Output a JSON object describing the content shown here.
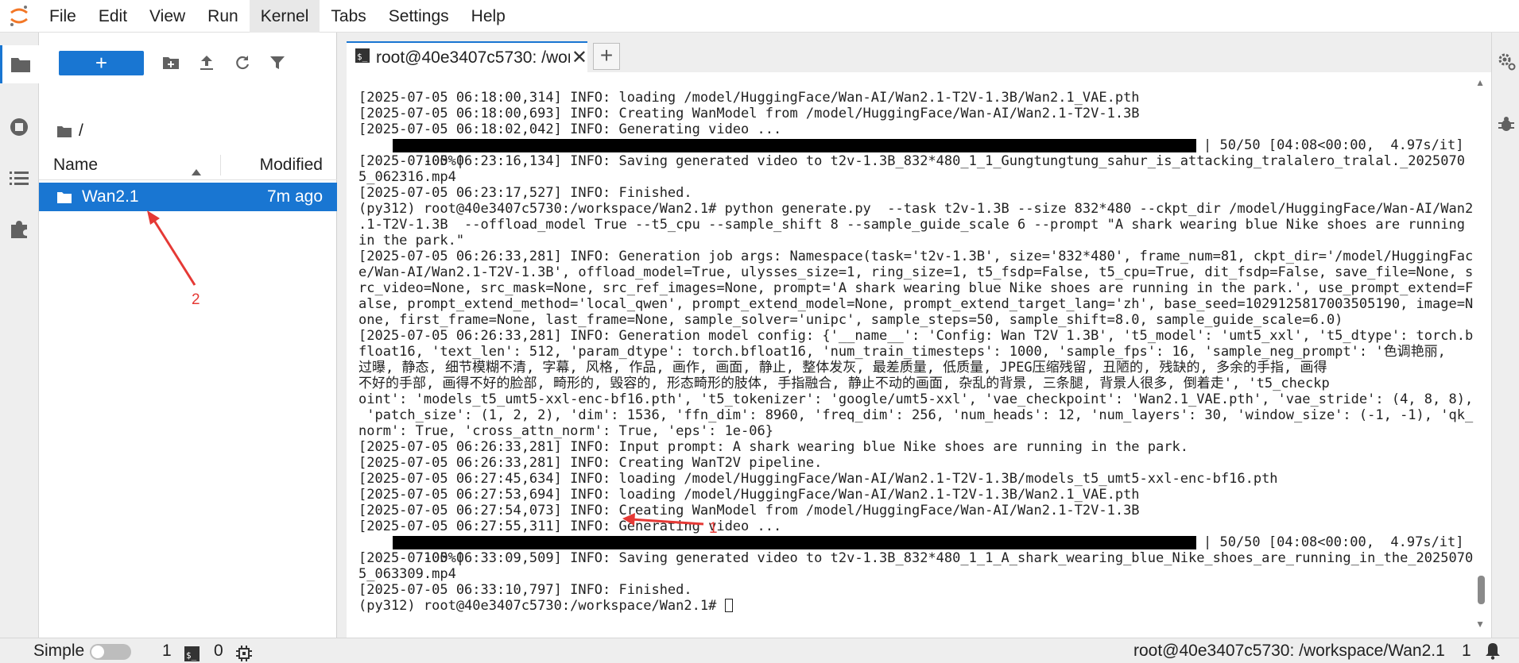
{
  "menu": [
    "File",
    "Edit",
    "View",
    "Run",
    "Kernel",
    "Tabs",
    "Settings",
    "Help"
  ],
  "filebrowser": {
    "new_label": "+",
    "breadcrumb": "/",
    "col_name": "Name",
    "col_modified": "Modified",
    "files": [
      {
        "name": "Wan2.1",
        "modified": "7m ago"
      }
    ]
  },
  "tab": {
    "label": "root@40e3407c5730: /wor",
    "close": "✕",
    "add": "+"
  },
  "terminal": {
    "lines_a": [
      "[2025-07-05 06:18:00,314] INFO: loading /model/HuggingFace/Wan-AI/Wan2.1-T2V-1.3B/Wan2.1_VAE.pth",
      "[2025-07-05 06:18:00,693] INFO: Creating WanModel from /model/HuggingFace/Wan-AI/Wan2.1-T2V-1.3B",
      "[2025-07-05 06:18:02,042] INFO: Generating video ..."
    ],
    "progress1_start": "100%|",
    "progress1_end": "| 50/50 [04:08<00:00,  4.97s/it]",
    "lines_b": [
      "[2025-07-05 06:23:16,134] INFO: Saving generated video to t2v-1.3B_832*480_1_1_Gungtungtung_sahur_is_attacking_tralalero_tralal._2025070",
      "5_062316.mp4",
      "[2025-07-05 06:23:17,527] INFO: Finished.",
      "(py312) root@40e3407c5730:/workspace/Wan2.1# python generate.py  --task t2v-1.3B --size 832*480 --ckpt_dir /model/HuggingFace/Wan-AI/Wan2",
      ".1-T2V-1.3B  --offload_model True --t5_cpu --sample_shift 8 --sample_guide_scale 6 --prompt \"A shark wearing blue Nike shoes are running",
      "in the park.\"",
      "[2025-07-05 06:26:33,281] INFO: Generation job args: Namespace(task='t2v-1.3B', size='832*480', frame_num=81, ckpt_dir='/model/HuggingFac",
      "e/Wan-AI/Wan2.1-T2V-1.3B', offload_model=True, ulysses_size=1, ring_size=1, t5_fsdp=False, t5_cpu=True, dit_fsdp=False, save_file=None, s",
      "rc_video=None, src_mask=None, src_ref_images=None, prompt='A shark wearing blue Nike shoes are running in the park.', use_prompt_extend=F",
      "alse, prompt_extend_method='local_qwen', prompt_extend_model=None, prompt_extend_target_lang='zh', base_seed=1029125817003505190, image=N",
      "one, first_frame=None, last_frame=None, sample_solver='unipc', sample_steps=50, sample_shift=8.0, sample_guide_scale=6.0)",
      "[2025-07-05 06:26:33,281] INFO: Generation model config: {'__name__': 'Config: Wan T2V 1.3B', 't5_model': 'umt5_xxl', 't5_dtype': torch.b",
      "float16, 'text_len': 512, 'param_dtype': torch.bfloat16, 'num_train_timesteps': 1000, 'sample_fps': 16, 'sample_neg_prompt': '色调艳丽,",
      "过曝, 静态, 细节模糊不清, 字幕, 风格, 作品, 画作, 画面, 静止, 整体发灰, 最差质量, 低质量, JPEG压缩残留, 丑陋的, 残缺的, 多余的手指, 画得",
      "不好的手部, 画得不好的脸部, 畸形的, 毁容的, 形态畸形的肢体, 手指融合, 静止不动的画面, 杂乱的背景, 三条腿, 背景人很多, 倒着走', 't5_checkp",
      "oint': 'models_t5_umt5-xxl-enc-bf16.pth', 't5_tokenizer': 'google/umt5-xxl', 'vae_checkpoint': 'Wan2.1_VAE.pth', 'vae_stride': (4, 8, 8),",
      " 'patch_size': (1, 2, 2), 'dim': 1536, 'ffn_dim': 8960, 'freq_dim': 256, 'num_heads': 12, 'num_layers': 30, 'window_size': (-1, -1), 'qk_",
      "norm': True, 'cross_attn_norm': True, 'eps': 1e-06}",
      "[2025-07-05 06:26:33,281] INFO: Input prompt: A shark wearing blue Nike shoes are running in the park.",
      "[2025-07-05 06:26:33,281] INFO: Creating WanT2V pipeline.",
      "[2025-07-05 06:27:45,634] INFO: loading /model/HuggingFace/Wan-AI/Wan2.1-T2V-1.3B/models_t5_umt5-xxl-enc-bf16.pth",
      "[2025-07-05 06:27:53,694] INFO: loading /model/HuggingFace/Wan-AI/Wan2.1-T2V-1.3B/Wan2.1_VAE.pth",
      "[2025-07-05 06:27:54,073] INFO: Creating WanModel from /model/HuggingFace/Wan-AI/Wan2.1-T2V-1.3B",
      "[2025-07-05 06:27:55,311] INFO: Generating video ..."
    ],
    "progress2_start": "100%|",
    "progress2_end": "| 50/50 [04:08<00:00,  4.97s/it]",
    "lines_c": [
      "[2025-07-05 06:33:09,509] INFO: Saving generated video to t2v-1.3B_832*480_1_1_A_shark_wearing_blue_Nike_shoes_are_running_in_the_2025070",
      "5_063309.mp4",
      "[2025-07-05 06:33:10,797] INFO: Finished."
    ],
    "prompt": "(py312) root@40e3407c5730:/workspace/Wan2.1# "
  },
  "statusbar": {
    "mode": "Simple",
    "kernels": "1",
    "terminals": "0",
    "path": "root@40e3407c5730: /workspace/Wan2.1",
    "count": "1"
  },
  "annotations": {
    "label1": "1",
    "label2": "2"
  },
  "colors": {
    "accent": "#1976d2",
    "annotation": "#e53935"
  }
}
